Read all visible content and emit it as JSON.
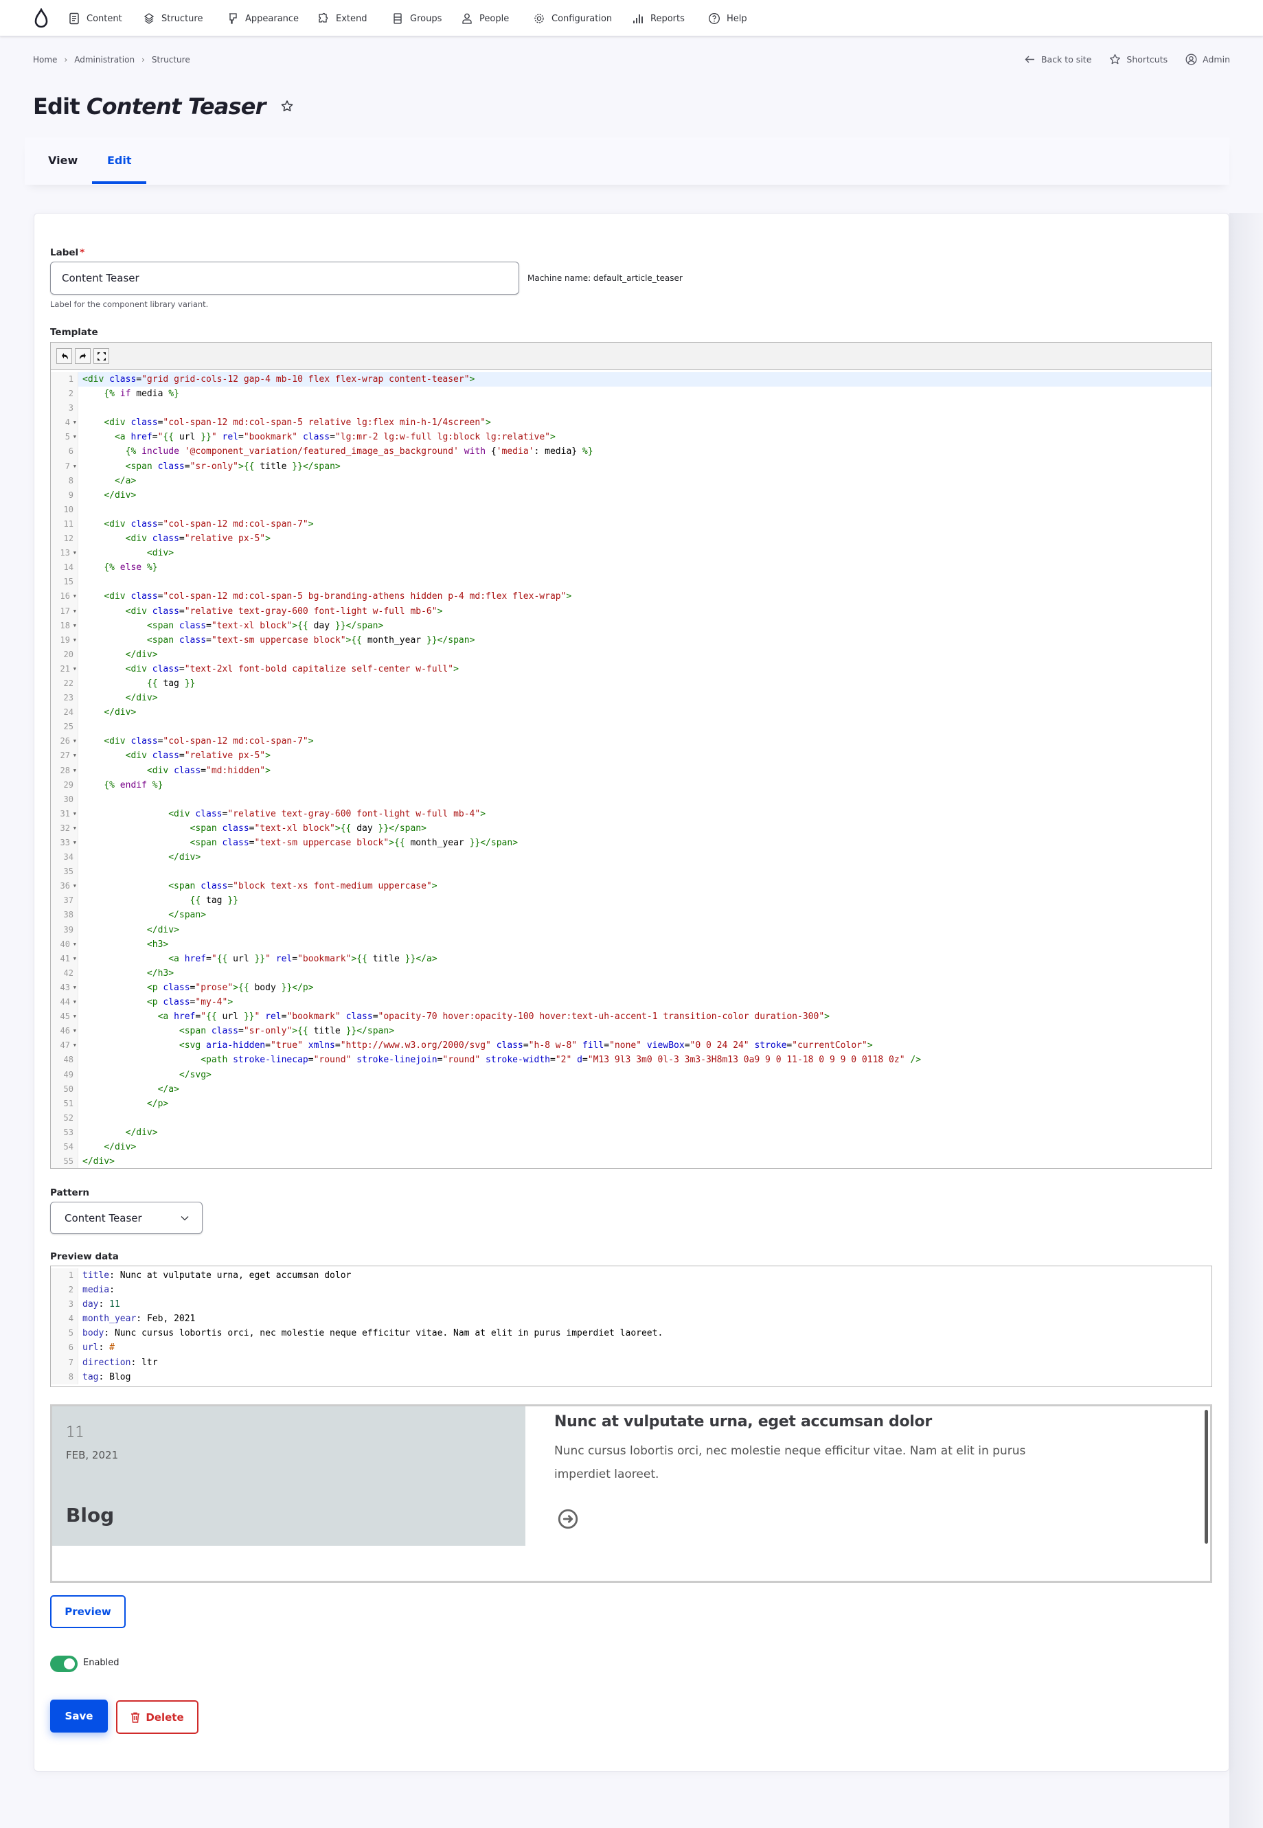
{
  "toolbar": {
    "items": [
      {
        "label": "Content",
        "icon": "content-icon"
      },
      {
        "label": "Structure",
        "icon": "structure-icon"
      },
      {
        "label": "Appearance",
        "icon": "appearance-icon"
      },
      {
        "label": "Extend",
        "icon": "extend-icon"
      },
      {
        "label": "Groups",
        "icon": "groups-icon"
      },
      {
        "label": "People",
        "icon": "people-icon"
      },
      {
        "label": "Configuration",
        "icon": "configuration-icon"
      },
      {
        "label": "Reports",
        "icon": "reports-icon"
      },
      {
        "label": "Help",
        "icon": "help-icon"
      }
    ]
  },
  "breadcrumb": [
    "Home",
    "Administration",
    "Structure"
  ],
  "meta_links": {
    "back": "Back to site",
    "shortcuts": "Shortcuts",
    "admin": "Admin"
  },
  "page": {
    "title_prefix": "Edit",
    "title_name": "Content Teaser"
  },
  "tabs": [
    {
      "label": "View",
      "active": false
    },
    {
      "label": "Edit",
      "active": true
    }
  ],
  "form": {
    "label_field": {
      "label": "Label",
      "required_mark": "*",
      "value": "Content Teaser",
      "machine_name": "Machine name: default_article_teaser",
      "help": "Label for the component library variant."
    },
    "template": {
      "label": "Template",
      "toolbar": [
        "undo-icon",
        "redo-icon",
        "fullscreen-icon"
      ],
      "lines": [
        "<div class=\"grid grid-cols-12 gap-4 mb-10 flex flex-wrap content-teaser\">",
        "    {% if media %}",
        "",
        "    <div class=\"col-span-12 md:col-span-5 relative lg:flex min-h-1/4screen\">",
        "      <a href=\"{{ url }}\" rel=\"bookmark\" class=\"lg:mr-2 lg:w-full lg:block lg:relative\">",
        "        {% include '@component_variation/featured_image_as_background' with {'media': media} %}",
        "        <span class=\"sr-only\">{{ title }}</span>",
        "      </a>",
        "    </div>",
        "",
        "    <div class=\"col-span-12 md:col-span-7\">",
        "        <div class=\"relative px-5\">",
        "            <div>",
        "    {% else %}",
        "",
        "    <div class=\"col-span-12 md:col-span-5 bg-branding-athens hidden p-4 md:flex flex-wrap\">",
        "        <div class=\"relative text-gray-600 font-light w-full mb-6\">",
        "            <span class=\"text-xl block\">{{ day }}</span>",
        "            <span class=\"text-sm uppercase block\">{{ month_year }}</span>",
        "        </div>",
        "        <div class=\"text-2xl font-bold capitalize self-center w-full\">",
        "            {{ tag }}",
        "        </div>",
        "    </div>",
        "",
        "    <div class=\"col-span-12 md:col-span-7\">",
        "        <div class=\"relative px-5\">",
        "            <div class=\"md:hidden\">",
        "    {% endif %}",
        "",
        "                <div class=\"relative text-gray-600 font-light w-full mb-4\">",
        "                    <span class=\"text-xl block\">{{ day }}</span>",
        "                    <span class=\"text-sm uppercase block\">{{ month_year }}</span>",
        "                </div>",
        "",
        "                <span class=\"block text-xs font-medium uppercase\">",
        "                    {{ tag }}",
        "                </span>",
        "            </div>",
        "            <h3>",
        "                <a href=\"{{ url }}\" rel=\"bookmark\">{{ title }}</a>",
        "            </h3>",
        "            <p class=\"prose\">{{ body }}</p>",
        "            <p class=\"my-4\">",
        "              <a href=\"{{ url }}\" rel=\"bookmark\" class=\"opacity-70 hover:opacity-100 hover:text-uh-accent-1 transition-color duration-300\">",
        "                  <span class=\"sr-only\">{{ title }}</span>",
        "                  <svg aria-hidden=\"true\" xmlns=\"http://www.w3.org/2000/svg\" class=\"h-8 w-8\" fill=\"none\" viewBox=\"0 0 24 24\" stroke=\"currentColor\">",
        "                      <path stroke-linecap=\"round\" stroke-linejoin=\"round\" stroke-width=\"2\" d=\"M13 9l3 3m0 0l-3 3m3-3H8m13 0a9 9 0 11-18 0 9 9 0 0118 0z\" />",
        "                  </svg>",
        "              </a>",
        "            </p>",
        "",
        "        </div>",
        "    </div>",
        "</div>"
      ],
      "fold_lines": [
        4,
        5,
        7,
        13,
        16,
        17,
        18,
        19,
        21,
        26,
        27,
        28,
        31,
        32,
        33,
        36,
        40,
        41,
        43,
        44,
        45,
        46,
        47
      ]
    },
    "pattern": {
      "label": "Pattern",
      "selected": "Content Teaser"
    },
    "preview_data": {
      "label": "Preview data",
      "lines": [
        {
          "key": "title",
          "value": "Nunc at vulputate urna, eget accumsan dolor",
          "type": "text"
        },
        {
          "key": "media",
          "value": "",
          "type": "text"
        },
        {
          "key": "day",
          "value": "11",
          "type": "num"
        },
        {
          "key": "month_year",
          "value": "Feb, 2021",
          "type": "text"
        },
        {
          "key": "body",
          "value": "Nunc cursus lobortis orci, nec molestie neque efficitur vitae. Nam at elit in purus imperdiet laoreet.",
          "type": "text"
        },
        {
          "key": "url",
          "value": "#",
          "type": "hash"
        },
        {
          "key": "direction",
          "value": "ltr",
          "type": "text"
        },
        {
          "key": "tag",
          "value": "Blog",
          "type": "text"
        }
      ]
    },
    "preview": {
      "day": "11",
      "month_year": "Feb, 2021",
      "tag": "Blog",
      "title": "Nunc at vulputate urna, eget accumsan dolor",
      "body": "Nunc cursus lobortis orci, nec molestie neque efficitur vitae. Nam at elit in purus imperdiet laoreet."
    },
    "preview_button": "Preview",
    "enabled": {
      "label": "Enabled",
      "checked": true
    },
    "save_button": "Save",
    "delete_button": "Delete"
  },
  "colors": {
    "accent": "#0550e6",
    "danger": "#d02b2b",
    "toggle_on": "#2ba566",
    "preview_panel": "#d5dcde"
  }
}
